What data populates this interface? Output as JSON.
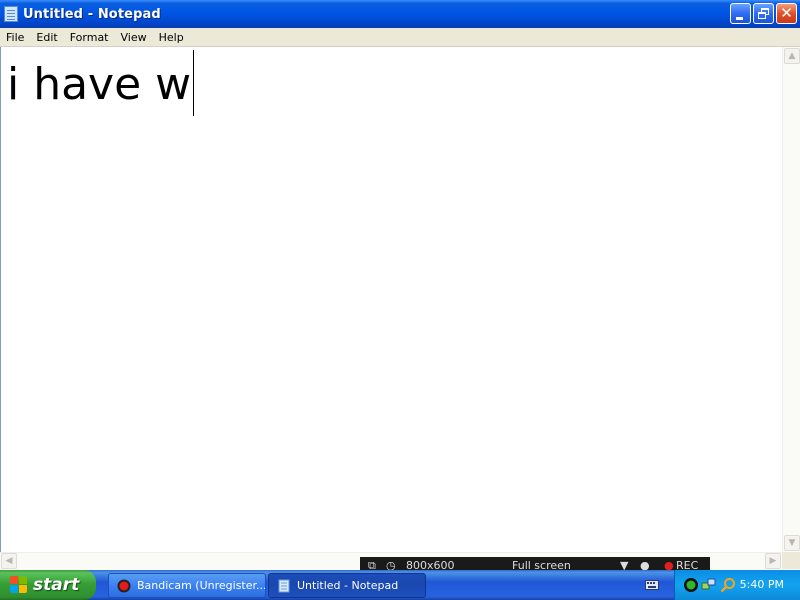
{
  "window": {
    "title": "Untitled - Notepad",
    "icon": "notepad-icon",
    "controls": {
      "minimize": "minimize-icon",
      "maximize": "restore-icon",
      "close": "close-icon"
    },
    "close_glyph": "✕"
  },
  "menu": [
    {
      "label": "File"
    },
    {
      "label": "Edit"
    },
    {
      "label": "Format"
    },
    {
      "label": "View"
    },
    {
      "label": "Help"
    }
  ],
  "editor": {
    "text": "i have w"
  },
  "recorder_overlay": {
    "resolution": "800x600",
    "mode": "Full screen",
    "rec": "REC"
  },
  "taskbar": {
    "start_label": "start",
    "tasks": [
      {
        "label": "Bandicam (Unregister...",
        "icon": "bandicam-icon",
        "active": false
      },
      {
        "label": "Untitled - Notepad",
        "icon": "notepad-icon",
        "active": true
      }
    ],
    "tray": {
      "icons": [
        "keyboard-icon",
        "bandicam-tray-icon",
        "network-icon",
        "search-icon"
      ],
      "clock": "5:40 PM"
    }
  },
  "colors": {
    "titlebar": "#0054e3",
    "menubar": "#ece9d8",
    "taskbar": "#245edb",
    "start_button": "#3c9b3c",
    "tray": "#0c8de4"
  }
}
